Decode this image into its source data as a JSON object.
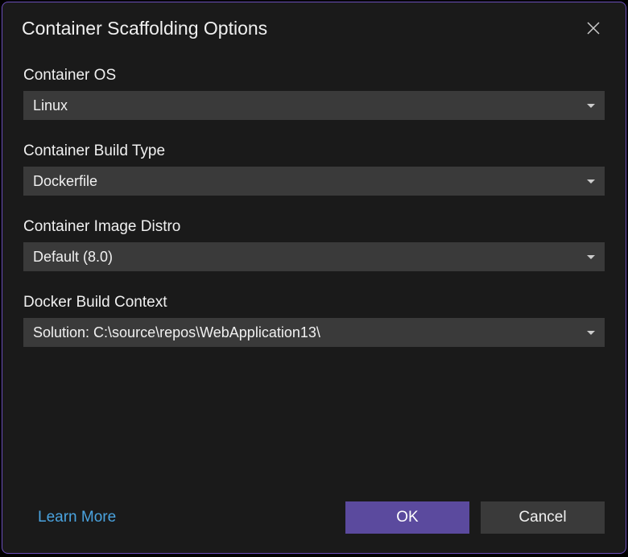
{
  "dialog": {
    "title": "Container Scaffolding Options"
  },
  "fields": {
    "container_os": {
      "label": "Container OS",
      "value": "Linux"
    },
    "build_type": {
      "label": "Container Build Type",
      "value": "Dockerfile"
    },
    "image_distro": {
      "label": "Container Image Distro",
      "value": "Default (8.0)"
    },
    "build_context": {
      "label": "Docker Build Context",
      "value": "Solution: C:\\source\\repos\\WebApplication13\\"
    }
  },
  "footer": {
    "learn_more": "Learn More",
    "ok": "OK",
    "cancel": "Cancel"
  }
}
